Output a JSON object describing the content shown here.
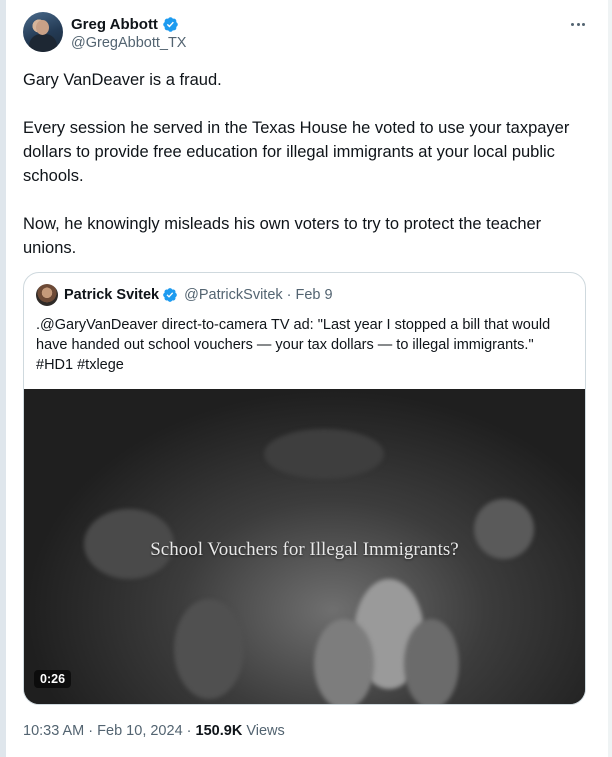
{
  "author": {
    "display_name": "Greg Abbott",
    "handle": "@GregAbbott_TX",
    "verified": true
  },
  "tweet": {
    "paragraphs": [
      "Gary VanDeaver is a fraud.",
      "Every session he served in the Texas House he voted to use your taxpayer dollars to provide free education for illegal immigrants at your local public schools.",
      "Now, he knowingly misleads his own voters to try to protect the teacher unions."
    ]
  },
  "quote": {
    "display_name": "Patrick Svitek",
    "handle": "@PatrickSvitek",
    "separator": "·",
    "date": "Feb 9",
    "text": ".@GaryVanDeaver direct-to-camera TV ad: \"Last year I stopped a bill that would have handed out school vouchers — your tax dollars — to illegal immigrants.\" #HD1 #txlege",
    "video": {
      "caption": "School Vouchers for Illegal Immigrants?",
      "duration": "0:26"
    }
  },
  "meta": {
    "time": "10:33 AM",
    "separator": "·",
    "date": "Feb 10, 2024",
    "views_count": "150.9K",
    "views_label": "Views"
  },
  "icons": {
    "verified": "verified-badge-icon",
    "more": "more-options-icon"
  },
  "colors": {
    "verified_blue": "#1d9bf0",
    "text_primary": "#0f1419",
    "text_secondary": "#536471",
    "border": "#cfd9de"
  }
}
